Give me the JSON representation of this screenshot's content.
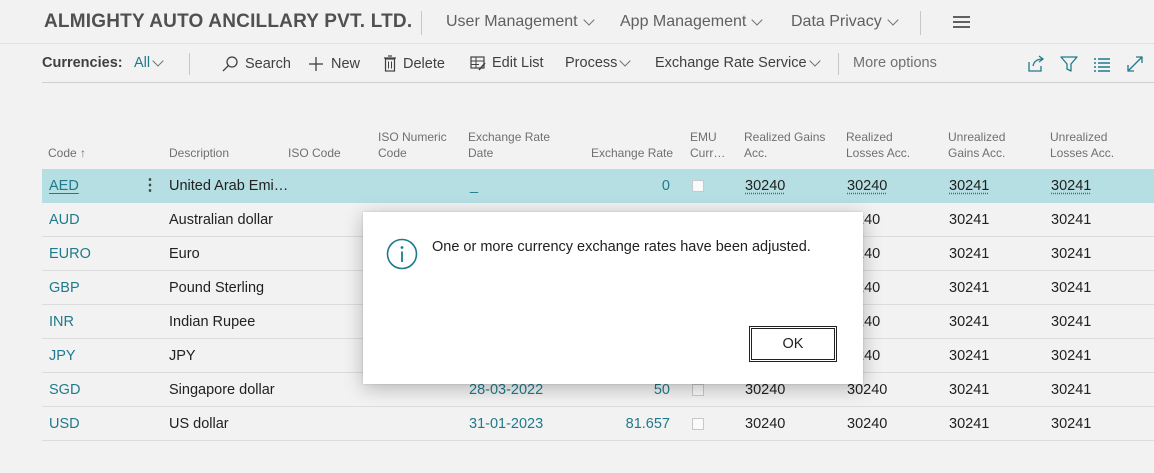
{
  "header": {
    "company": "ALMIGHTY AUTO ANCILLARY PVT. LTD.",
    "nav": [
      "User Management",
      "App Management",
      "Data Privacy"
    ]
  },
  "actionbar": {
    "label": "Currencies:",
    "filter": "All",
    "search": "Search",
    "new": "New",
    "delete": "Delete",
    "edit_list": "Edit List",
    "process": "Process",
    "exchange_rate_service": "Exchange Rate Service",
    "more_options": "More options"
  },
  "columns": {
    "code": "Code",
    "code_sort": "↑",
    "description": "Description",
    "iso_code": "ISO Code",
    "iso_numeric_1": "ISO Numeric",
    "iso_numeric_2": "Code",
    "exr_date_1": "Exchange Rate",
    "exr_date_2": "Date",
    "exchange_rate": "Exchange Rate",
    "emu_1": "EMU",
    "emu_2": "Curr…",
    "rg_1": "Realized Gains",
    "rg_2": "Acc.",
    "rl_1": "Realized",
    "rl_2": "Losses Acc.",
    "ug_1": "Unrealized",
    "ug_2": "Gains Acc.",
    "ul_1": "Unrealized",
    "ul_2": "Losses Acc."
  },
  "rows": [
    {
      "code": "AED",
      "description": "United Arab Emi…",
      "date": "_",
      "rate": "0",
      "rg": "30240",
      "rl": "30240",
      "ug": "30241",
      "ul": "30241"
    },
    {
      "code": "AUD",
      "description": "Australian dollar",
      "date": "",
      "rate": "",
      "rg": "",
      "rl": "240",
      "ug": "30241",
      "ul": "30241"
    },
    {
      "code": "EURO",
      "description": "Euro",
      "date": "",
      "rate": "",
      "rg": "",
      "rl": "240",
      "ug": "30241",
      "ul": "30241"
    },
    {
      "code": "GBP",
      "description": "Pound Sterling",
      "date": "",
      "rate": "",
      "rg": "",
      "rl": "240",
      "ug": "30241",
      "ul": "30241"
    },
    {
      "code": "INR",
      "description": "Indian Rupee",
      "date": "",
      "rate": "",
      "rg": "",
      "rl": "240",
      "ug": "30241",
      "ul": "30241"
    },
    {
      "code": "JPY",
      "description": "JPY",
      "date": "",
      "rate": "",
      "rg": "",
      "rl": "240",
      "ug": "30241",
      "ul": "30241"
    },
    {
      "code": "SGD",
      "description": "Singapore dollar",
      "date": "28-03-2022",
      "rate": "50",
      "rg": "30240",
      "rl": "30240",
      "ug": "30241",
      "ul": "30241"
    },
    {
      "code": "USD",
      "description": "US dollar",
      "date": "31-01-2023",
      "rate": "81.657",
      "rg": "30240",
      "rl": "30240",
      "ug": "30241",
      "ul": "30241"
    }
  ],
  "dialog": {
    "message": "One or more currency exchange rates have been adjusted.",
    "ok": "OK"
  },
  "colors": {
    "accent": "#1f7a8c",
    "selected_row": "#b5dfe2"
  }
}
